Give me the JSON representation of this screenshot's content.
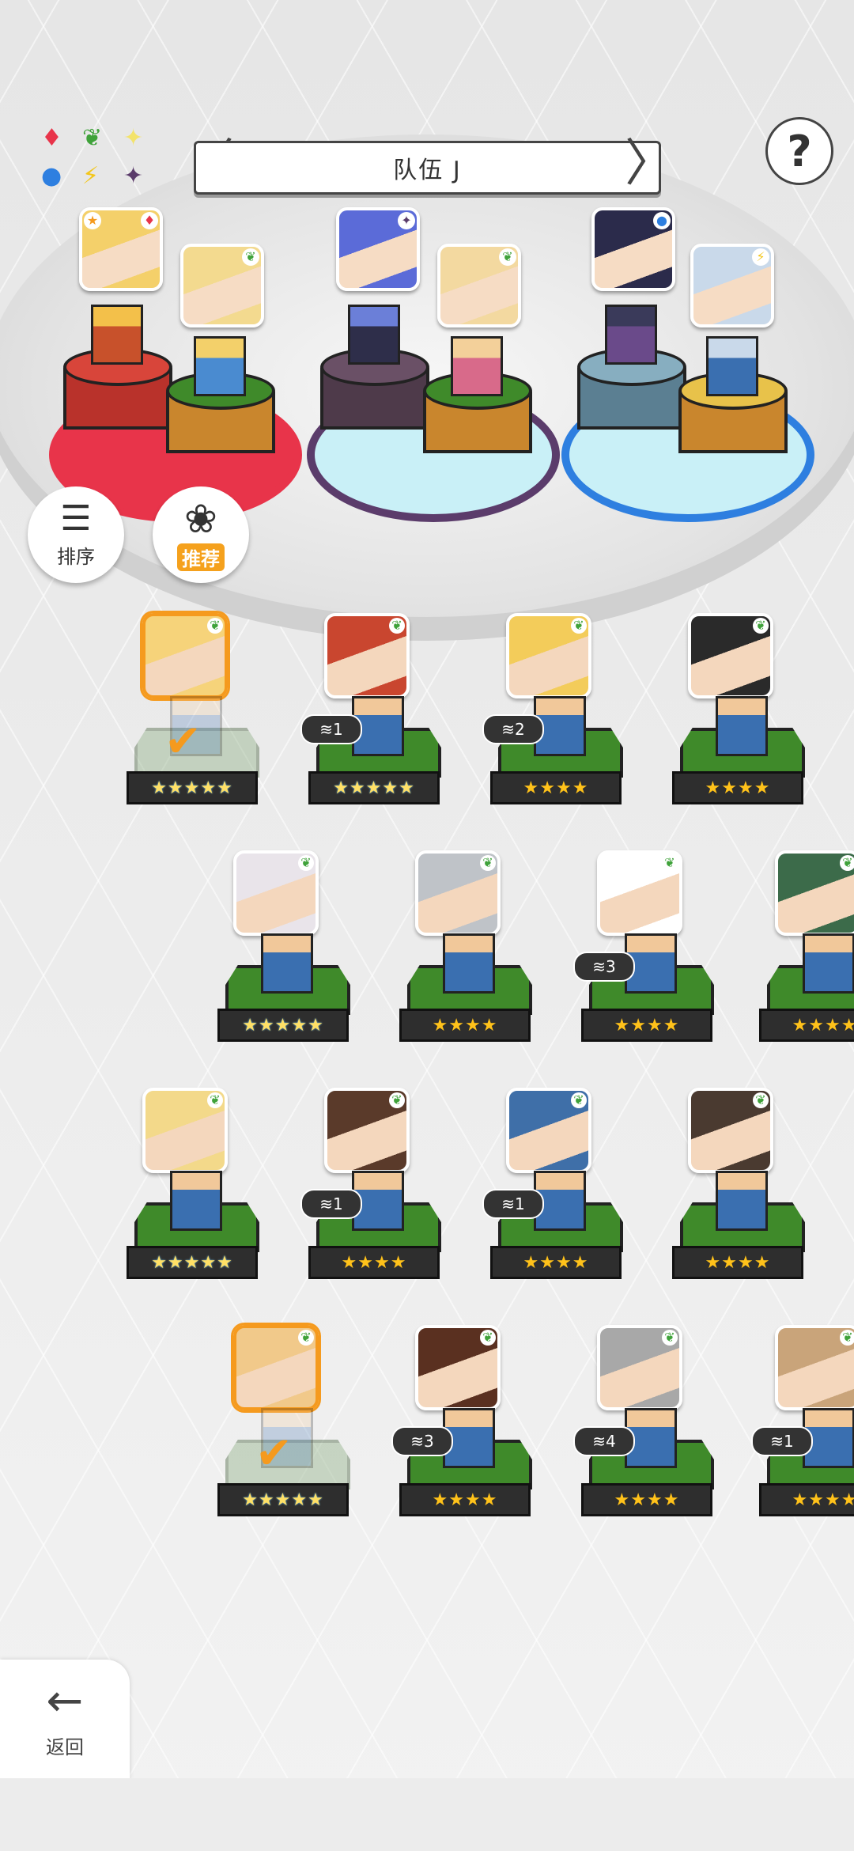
{
  "header": {
    "team_name": "队伍 J",
    "prev_arrow": "〈",
    "next_arrow": "〉",
    "help_icon": "?"
  },
  "element_wheel": {
    "icons": [
      "fire-diamond-icon",
      "leaf-icon",
      "sparkle-icon",
      "water-circle-icon",
      "lightning-icon",
      "dark-star-icon"
    ],
    "glyphs": [
      "♦",
      "❦",
      "✦",
      "●",
      "⚡",
      "✦"
    ],
    "colors": [
      "#e8344a",
      "#3fa23a",
      "#f3e36a",
      "#2e7fe0",
      "#f3c61a",
      "#5b3c6b"
    ]
  },
  "team_slots": [
    {
      "element": "fire",
      "element_glyph": "♦",
      "color": "#e8344a",
      "has_star": true,
      "star_glyph": "★"
    },
    {
      "element": "leaf",
      "element_glyph": "❦",
      "color": "#3fa23a"
    },
    {
      "element": "dark",
      "element_glyph": "✦",
      "color": "#5b3c6b"
    },
    {
      "element": "leaf",
      "element_glyph": "❦",
      "color": "#3fa23a"
    },
    {
      "element": "water",
      "element_glyph": "●",
      "color": "#2e7fe0"
    },
    {
      "element": "lightning",
      "element_glyph": "⚡",
      "color": "#f3c61a"
    }
  ],
  "controls": {
    "sort_label": "排序",
    "recommend_label": "推荐",
    "back_label": "返回",
    "back_icon": "←",
    "sort_icon": "☰",
    "recommend_icon": "❀"
  },
  "roster": [
    {
      "stars": "★★★★★",
      "rainbow": true,
      "selected": true,
      "dup": "",
      "check": true
    },
    {
      "stars": "★★★★★",
      "rainbow": true,
      "selected": false,
      "dup": "1",
      "check": false
    },
    {
      "stars": "★★★★",
      "rainbow": false,
      "selected": false,
      "dup": "2",
      "check": false
    },
    {
      "stars": "★★★★",
      "rainbow": false,
      "selected": false,
      "dup": "",
      "check": false
    },
    {
      "stars": "★★★★★",
      "rainbow": true,
      "selected": false,
      "dup": "",
      "check": false
    },
    {
      "stars": "★★★★",
      "rainbow": false,
      "selected": false,
      "dup": "",
      "check": false
    },
    {
      "stars": "★★★★",
      "rainbow": false,
      "selected": false,
      "dup": "3",
      "check": false
    },
    {
      "stars": "★★★★",
      "rainbow": false,
      "selected": false,
      "dup": "",
      "check": false
    },
    {
      "stars": "★★★★★",
      "rainbow": true,
      "selected": false,
      "dup": "",
      "check": false
    },
    {
      "stars": "★★★★",
      "rainbow": false,
      "selected": false,
      "dup": "1",
      "check": false
    },
    {
      "stars": "★★★★",
      "rainbow": false,
      "selected": false,
      "dup": "1",
      "check": false
    },
    {
      "stars": "★★★★",
      "rainbow": false,
      "selected": false,
      "dup": "",
      "check": false
    },
    {
      "stars": "★★★★★",
      "rainbow": true,
      "selected": true,
      "dup": "",
      "check": true
    },
    {
      "stars": "★★★★",
      "rainbow": false,
      "selected": false,
      "dup": "3",
      "check": false
    },
    {
      "stars": "★★★★",
      "rainbow": false,
      "selected": false,
      "dup": "4",
      "check": false
    },
    {
      "stars": "★★★★",
      "rainbow": false,
      "selected": false,
      "dup": "1",
      "check": false
    }
  ],
  "portrait_colors": [
    "#f6d37a",
    "#c9462f",
    "#f3cc5a",
    "#2a2a2a",
    "#e9e4ea",
    "#bfc3c8",
    "#ffffff",
    "#3c6b4a",
    "#f3d98a",
    "#5a3a2a",
    "#3f6fa8",
    "#4a3a30",
    "#f1c98a",
    "#5a3020",
    "#a8a8a8",
    "#c9a47a"
  ],
  "slot_portrait_colors": [
    "#f4d06a",
    "#f3da8f",
    "#5b6bd8",
    "#f3d9a0",
    "#2b2b4b",
    "#c9d9ea"
  ]
}
